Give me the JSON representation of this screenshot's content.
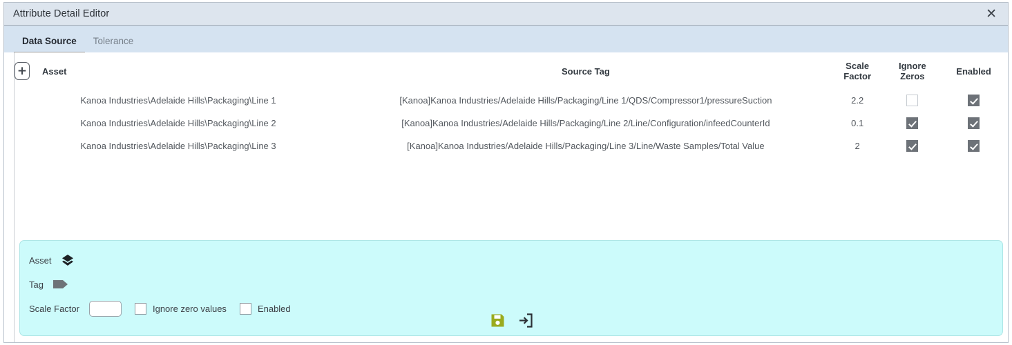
{
  "window": {
    "title": "Attribute Detail Editor",
    "close_label": "✕",
    "close_icon": "close-icon"
  },
  "tabs": [
    {
      "label": "Data Source",
      "active": true
    },
    {
      "label": "Tolerance",
      "active": false
    }
  ],
  "table": {
    "add_button_label": "+",
    "add_button_icon": "plus-icon",
    "columns": [
      {
        "key": "asset",
        "label": "Asset"
      },
      {
        "key": "source_tag",
        "label": "Source Tag"
      },
      {
        "key": "scale_factor",
        "label_line1": "Scale",
        "label_line2": "Factor"
      },
      {
        "key": "ignore_zeros",
        "label_line1": "Ignore",
        "label_line2": "Zeros"
      },
      {
        "key": "enabled",
        "label": "Enabled"
      }
    ],
    "rows": [
      {
        "asset": "Kanoa Industries\\Adelaide Hills\\Packaging\\Line 1",
        "source_tag": "[Kanoa]Kanoa Industries/Adelaide Hills/Packaging/Line 1/QDS/Compressor1/pressureSuction",
        "scale_factor": "2.2",
        "ignore_zeros": false,
        "enabled": true
      },
      {
        "asset": "Kanoa Industries\\Adelaide Hills\\Packaging\\Line 2",
        "source_tag": "[Kanoa]Kanoa Industries/Adelaide Hills/Packaging/Line 2/Line/Configuration/infeedCounterId",
        "scale_factor": "0.1",
        "ignore_zeros": true,
        "enabled": true
      },
      {
        "asset": "Kanoa Industries\\Adelaide Hills\\Packaging\\Line 3",
        "source_tag": "[Kanoa]Kanoa Industries/Adelaide Hills/Packaging/Line 3/Line/Waste Samples/Total Value",
        "scale_factor": "2",
        "ignore_zeros": true,
        "enabled": true
      }
    ]
  },
  "editor": {
    "asset_label": "Asset",
    "asset_icon": "layers-icon",
    "tag_label": "Tag",
    "tag_icon": "tag-icon",
    "scale_factor_label": "Scale Factor",
    "scale_factor_value": "",
    "scale_factor_placeholder": "",
    "ignore_zero_label": "Ignore zero values",
    "ignore_zero_checked": false,
    "enabled_label": "Enabled",
    "enabled_checked": false,
    "save_icon": "save-icon",
    "exit_icon": "exit-icon"
  },
  "colors": {
    "titlebar": "#dde5ee",
    "tabstrip": "#d5e3f1",
    "panel": "#ccfbfb",
    "checkbox_checked": "#6d7278",
    "save_icon": "#9aab1e",
    "exit_icon": "#2c3136"
  }
}
